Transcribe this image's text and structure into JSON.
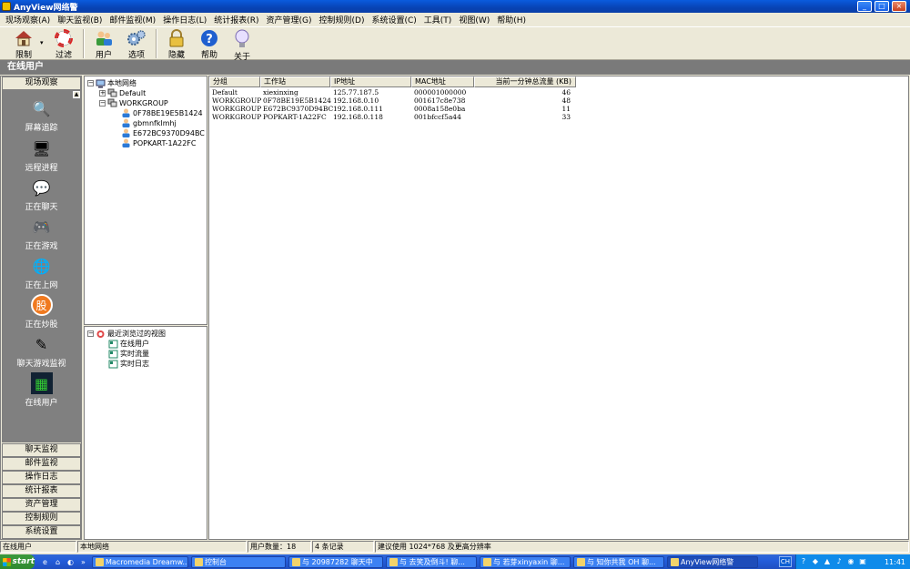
{
  "window": {
    "title": "AnyView网络警",
    "min": "_",
    "max": "□",
    "close": "×"
  },
  "menu": [
    "现场观察(A)",
    "聊天监视(B)",
    "邮件监视(M)",
    "操作日志(L)",
    "统计报表(R)",
    "资产管理(G)",
    "控制规则(D)",
    "系统设置(C)",
    "工具(T)",
    "视图(W)",
    "帮助(H)"
  ],
  "toolbar": {
    "limit": "限制",
    "filter": "过滤",
    "user": "用户",
    "options": "选项",
    "hide": "隐藏",
    "help": "帮助",
    "about": "关于",
    "dropdown": "▾",
    "icons": [
      "house-icon",
      "lifebuoy-icon",
      "users-icon",
      "gears-icon",
      "lock-icon",
      "help-icon",
      "bulb-icon"
    ]
  },
  "section_title": "在线用户",
  "leftnav": {
    "top_button": "现场观察",
    "scroll": "▲",
    "items": [
      {
        "label": "屏幕追踪",
        "icon": "🔍"
      },
      {
        "label": "远程进程",
        "icon": "🖥"
      },
      {
        "label": "正在聊天",
        "icon": "💬"
      },
      {
        "label": "正在游戏",
        "icon": "🎮"
      },
      {
        "label": "正在上网",
        "icon": "🌐"
      },
      {
        "label": "正在炒股",
        "icon": "股"
      },
      {
        "label": "聊天游戏监视",
        "icon": "✎"
      },
      {
        "label": "在线用户",
        "icon": "▦"
      }
    ],
    "bottom_buttons": [
      "聊天监视",
      "邮件监视",
      "操作日志",
      "统计报表",
      "资产管理",
      "控制规则",
      "系统设置"
    ]
  },
  "tree": {
    "root": "本地网络",
    "default_group": "Default",
    "workgroup": "WORKGROUP",
    "hosts": [
      "0F78BE19E5B1424",
      "gbmnfklmhj",
      "E672BC9370D94BC",
      "POPKART-1A22FC"
    ],
    "expanded": "−",
    "collapsed": "+"
  },
  "recent_views": {
    "title": "最近浏览过的视图",
    "items": [
      "在线用户",
      "实时流量",
      "实时日志"
    ],
    "expanded": "−"
  },
  "table": {
    "columns": [
      "分组",
      "工作站",
      "IP地址",
      "MAC地址",
      "当前一分钟总流量 (KB)"
    ],
    "rows": [
      [
        "Default",
        "xiexinxing",
        "125.77.187.5",
        "000001000000",
        "46"
      ],
      [
        "WORKGROUP",
        "0F78BE19E5B1424",
        "192.168.0.10",
        "001617c8e738",
        "48"
      ],
      [
        "WORKGROUP",
        "E672BC9370D94BC",
        "192.168.0.111",
        "0008a158e0ba",
        "11"
      ],
      [
        "WORKGROUP",
        "POPKART-1A22FC",
        "192.168.0.118",
        "001bfccf5a44",
        "33"
      ]
    ]
  },
  "statusbar": [
    "在线用户",
    "本地网络",
    "用户数量：18",
    "4 条记录",
    "建议使用 1024*768 及更高分辨率"
  ],
  "taskbar": {
    "start": "start",
    "quicklaunch": [
      "e",
      "⌂",
      "◐",
      "»"
    ],
    "tasks": [
      "Macromedia Dreamw...",
      "控制台",
      "与 20987282 聊天中",
      "与 去笑及倒斗! 聊...",
      "与 若芽xinyaxin 聊...",
      "与 知你共我 OH 聊...",
      "AnyView网络警"
    ],
    "lang": "CH",
    "tray": [
      "?",
      "◆",
      "▲",
      "♪",
      "◉",
      "▣"
    ],
    "clock": "11:41"
  }
}
